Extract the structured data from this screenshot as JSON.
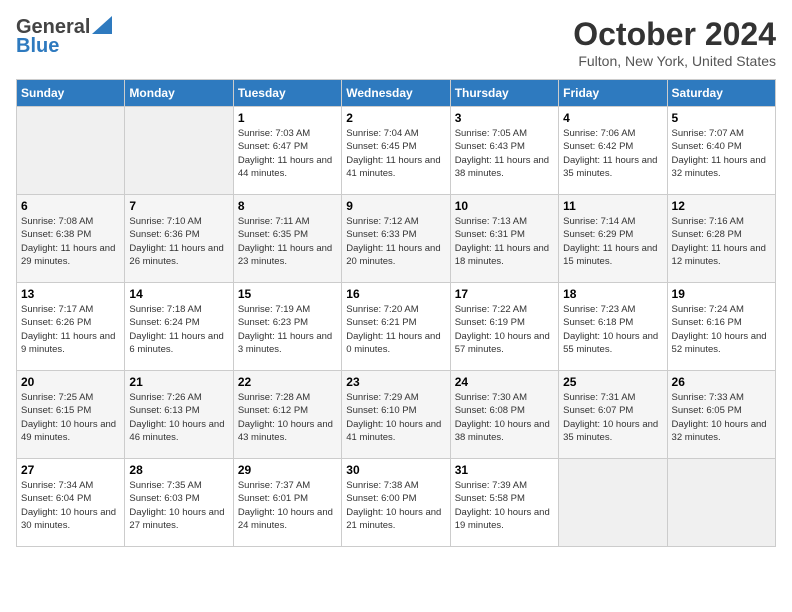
{
  "header": {
    "logo_line1": "General",
    "logo_line2": "Blue",
    "month_title": "October 2024",
    "location": "Fulton, New York, United States"
  },
  "days_of_week": [
    "Sunday",
    "Monday",
    "Tuesday",
    "Wednesday",
    "Thursday",
    "Friday",
    "Saturday"
  ],
  "weeks": [
    [
      {
        "num": "",
        "info": ""
      },
      {
        "num": "",
        "info": ""
      },
      {
        "num": "1",
        "info": "Sunrise: 7:03 AM\nSunset: 6:47 PM\nDaylight: 11 hours and 44 minutes."
      },
      {
        "num": "2",
        "info": "Sunrise: 7:04 AM\nSunset: 6:45 PM\nDaylight: 11 hours and 41 minutes."
      },
      {
        "num": "3",
        "info": "Sunrise: 7:05 AM\nSunset: 6:43 PM\nDaylight: 11 hours and 38 minutes."
      },
      {
        "num": "4",
        "info": "Sunrise: 7:06 AM\nSunset: 6:42 PM\nDaylight: 11 hours and 35 minutes."
      },
      {
        "num": "5",
        "info": "Sunrise: 7:07 AM\nSunset: 6:40 PM\nDaylight: 11 hours and 32 minutes."
      }
    ],
    [
      {
        "num": "6",
        "info": "Sunrise: 7:08 AM\nSunset: 6:38 PM\nDaylight: 11 hours and 29 minutes."
      },
      {
        "num": "7",
        "info": "Sunrise: 7:10 AM\nSunset: 6:36 PM\nDaylight: 11 hours and 26 minutes."
      },
      {
        "num": "8",
        "info": "Sunrise: 7:11 AM\nSunset: 6:35 PM\nDaylight: 11 hours and 23 minutes."
      },
      {
        "num": "9",
        "info": "Sunrise: 7:12 AM\nSunset: 6:33 PM\nDaylight: 11 hours and 20 minutes."
      },
      {
        "num": "10",
        "info": "Sunrise: 7:13 AM\nSunset: 6:31 PM\nDaylight: 11 hours and 18 minutes."
      },
      {
        "num": "11",
        "info": "Sunrise: 7:14 AM\nSunset: 6:29 PM\nDaylight: 11 hours and 15 minutes."
      },
      {
        "num": "12",
        "info": "Sunrise: 7:16 AM\nSunset: 6:28 PM\nDaylight: 11 hours and 12 minutes."
      }
    ],
    [
      {
        "num": "13",
        "info": "Sunrise: 7:17 AM\nSunset: 6:26 PM\nDaylight: 11 hours and 9 minutes."
      },
      {
        "num": "14",
        "info": "Sunrise: 7:18 AM\nSunset: 6:24 PM\nDaylight: 11 hours and 6 minutes."
      },
      {
        "num": "15",
        "info": "Sunrise: 7:19 AM\nSunset: 6:23 PM\nDaylight: 11 hours and 3 minutes."
      },
      {
        "num": "16",
        "info": "Sunrise: 7:20 AM\nSunset: 6:21 PM\nDaylight: 11 hours and 0 minutes."
      },
      {
        "num": "17",
        "info": "Sunrise: 7:22 AM\nSunset: 6:19 PM\nDaylight: 10 hours and 57 minutes."
      },
      {
        "num": "18",
        "info": "Sunrise: 7:23 AM\nSunset: 6:18 PM\nDaylight: 10 hours and 55 minutes."
      },
      {
        "num": "19",
        "info": "Sunrise: 7:24 AM\nSunset: 6:16 PM\nDaylight: 10 hours and 52 minutes."
      }
    ],
    [
      {
        "num": "20",
        "info": "Sunrise: 7:25 AM\nSunset: 6:15 PM\nDaylight: 10 hours and 49 minutes."
      },
      {
        "num": "21",
        "info": "Sunrise: 7:26 AM\nSunset: 6:13 PM\nDaylight: 10 hours and 46 minutes."
      },
      {
        "num": "22",
        "info": "Sunrise: 7:28 AM\nSunset: 6:12 PM\nDaylight: 10 hours and 43 minutes."
      },
      {
        "num": "23",
        "info": "Sunrise: 7:29 AM\nSunset: 6:10 PM\nDaylight: 10 hours and 41 minutes."
      },
      {
        "num": "24",
        "info": "Sunrise: 7:30 AM\nSunset: 6:08 PM\nDaylight: 10 hours and 38 minutes."
      },
      {
        "num": "25",
        "info": "Sunrise: 7:31 AM\nSunset: 6:07 PM\nDaylight: 10 hours and 35 minutes."
      },
      {
        "num": "26",
        "info": "Sunrise: 7:33 AM\nSunset: 6:05 PM\nDaylight: 10 hours and 32 minutes."
      }
    ],
    [
      {
        "num": "27",
        "info": "Sunrise: 7:34 AM\nSunset: 6:04 PM\nDaylight: 10 hours and 30 minutes."
      },
      {
        "num": "28",
        "info": "Sunrise: 7:35 AM\nSunset: 6:03 PM\nDaylight: 10 hours and 27 minutes."
      },
      {
        "num": "29",
        "info": "Sunrise: 7:37 AM\nSunset: 6:01 PM\nDaylight: 10 hours and 24 minutes."
      },
      {
        "num": "30",
        "info": "Sunrise: 7:38 AM\nSunset: 6:00 PM\nDaylight: 10 hours and 21 minutes."
      },
      {
        "num": "31",
        "info": "Sunrise: 7:39 AM\nSunset: 5:58 PM\nDaylight: 10 hours and 19 minutes."
      },
      {
        "num": "",
        "info": ""
      },
      {
        "num": "",
        "info": ""
      }
    ]
  ]
}
